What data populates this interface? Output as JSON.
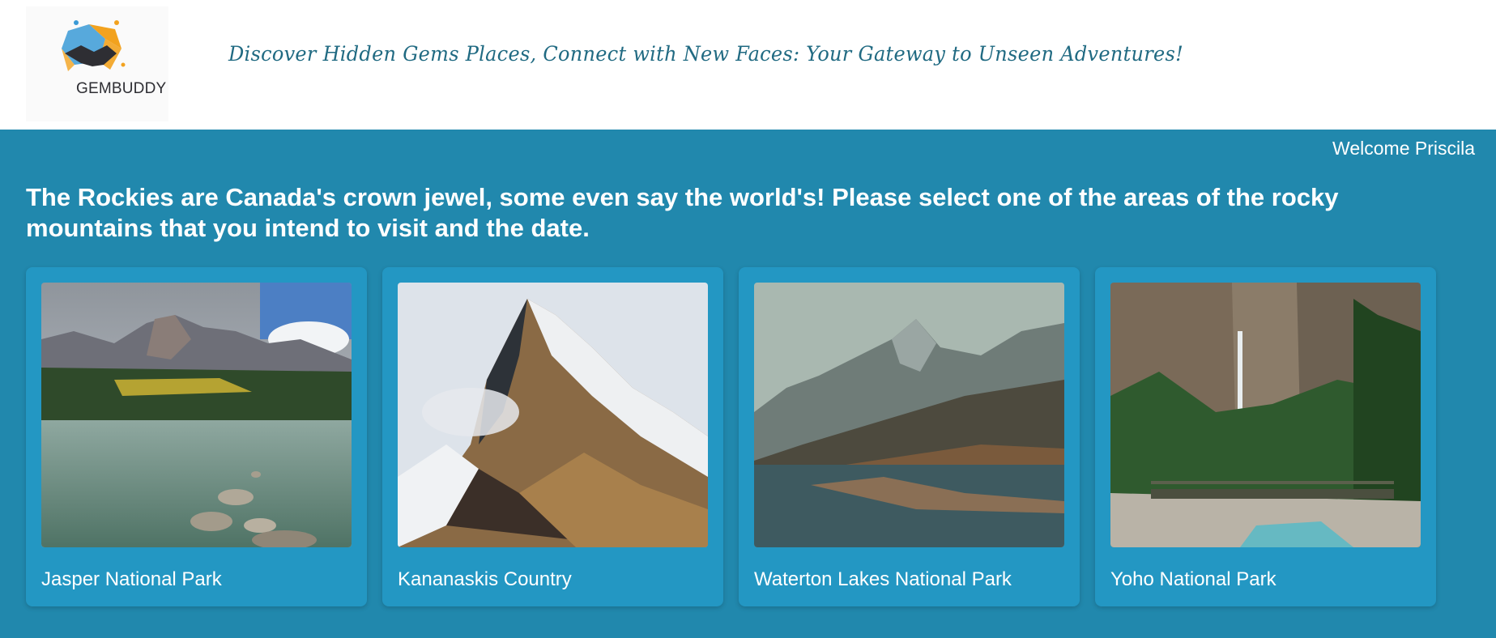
{
  "header": {
    "logo_text": "GEMBUDDY",
    "tagline": "Discover Hidden Gems Places, Connect with New Faces: Your Gateway to Unseen Adventures!"
  },
  "user": {
    "welcome": "Welcome Priscila"
  },
  "main": {
    "intro": "The Rockies are Canada's crown jewel, some even say the world's! Please select one of the areas of the rocky mountains that you intend to visit and the date.",
    "destinations": [
      {
        "name": "Jasper National Park"
      },
      {
        "name": "Kananaskis Country"
      },
      {
        "name": "Waterton Lakes National Park"
      },
      {
        "name": "Yoho National Park"
      }
    ]
  },
  "colors": {
    "page_background": "#2188ad",
    "card_background": "#2397c3",
    "tagline": "#206a82",
    "logo_orange": "#f2a21e",
    "logo_blue": "#3a9ad6"
  }
}
